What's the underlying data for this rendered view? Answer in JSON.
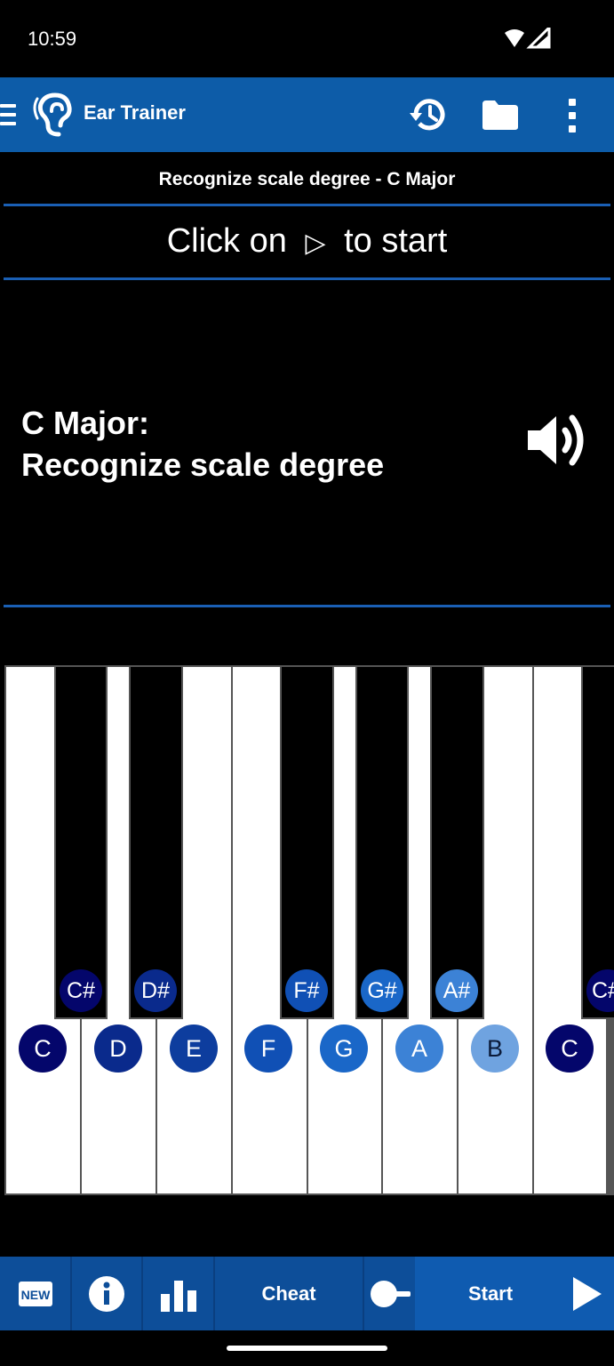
{
  "status": {
    "time": "10:59"
  },
  "app": {
    "title": "Ear Trainer"
  },
  "subtitle": "Recognize scale degree - C Major",
  "prompt": {
    "before": "Click on",
    "symbol": "▷",
    "after": "to start"
  },
  "exercise": {
    "line1": "C Major:",
    "line2": "Recognize scale degree"
  },
  "piano": {
    "white_notes": [
      {
        "label": "C",
        "color": "#04066b"
      },
      {
        "label": "D",
        "color": "#0a2a8c"
      },
      {
        "label": "E",
        "color": "#0d3d9e"
      },
      {
        "label": "F",
        "color": "#1050b5"
      },
      {
        "label": "G",
        "color": "#1a67c8"
      },
      {
        "label": "A",
        "color": "#3c82d6"
      },
      {
        "label": "B",
        "color": "#6fa3e0",
        "text": "#0b1b3a"
      },
      {
        "label": "C",
        "color": "#04066b"
      }
    ],
    "black_notes": [
      {
        "label": "C#",
        "color": "#04066b"
      },
      {
        "label": "D#",
        "color": "#0a2a8c"
      },
      {
        "label": "F#",
        "color": "#1050b5"
      },
      {
        "label": "G#",
        "color": "#1a67c8"
      },
      {
        "label": "A#",
        "color": "#3c82d6"
      },
      {
        "label": "C#",
        "color": "#04066b"
      }
    ]
  },
  "bottombar": {
    "new_label": "NEW",
    "cheat_label": "Cheat",
    "start_label": "Start"
  },
  "colors": {
    "accent": "#0d5ca8",
    "divider": "#1a5fb4",
    "bottom": "#0a3f80"
  }
}
